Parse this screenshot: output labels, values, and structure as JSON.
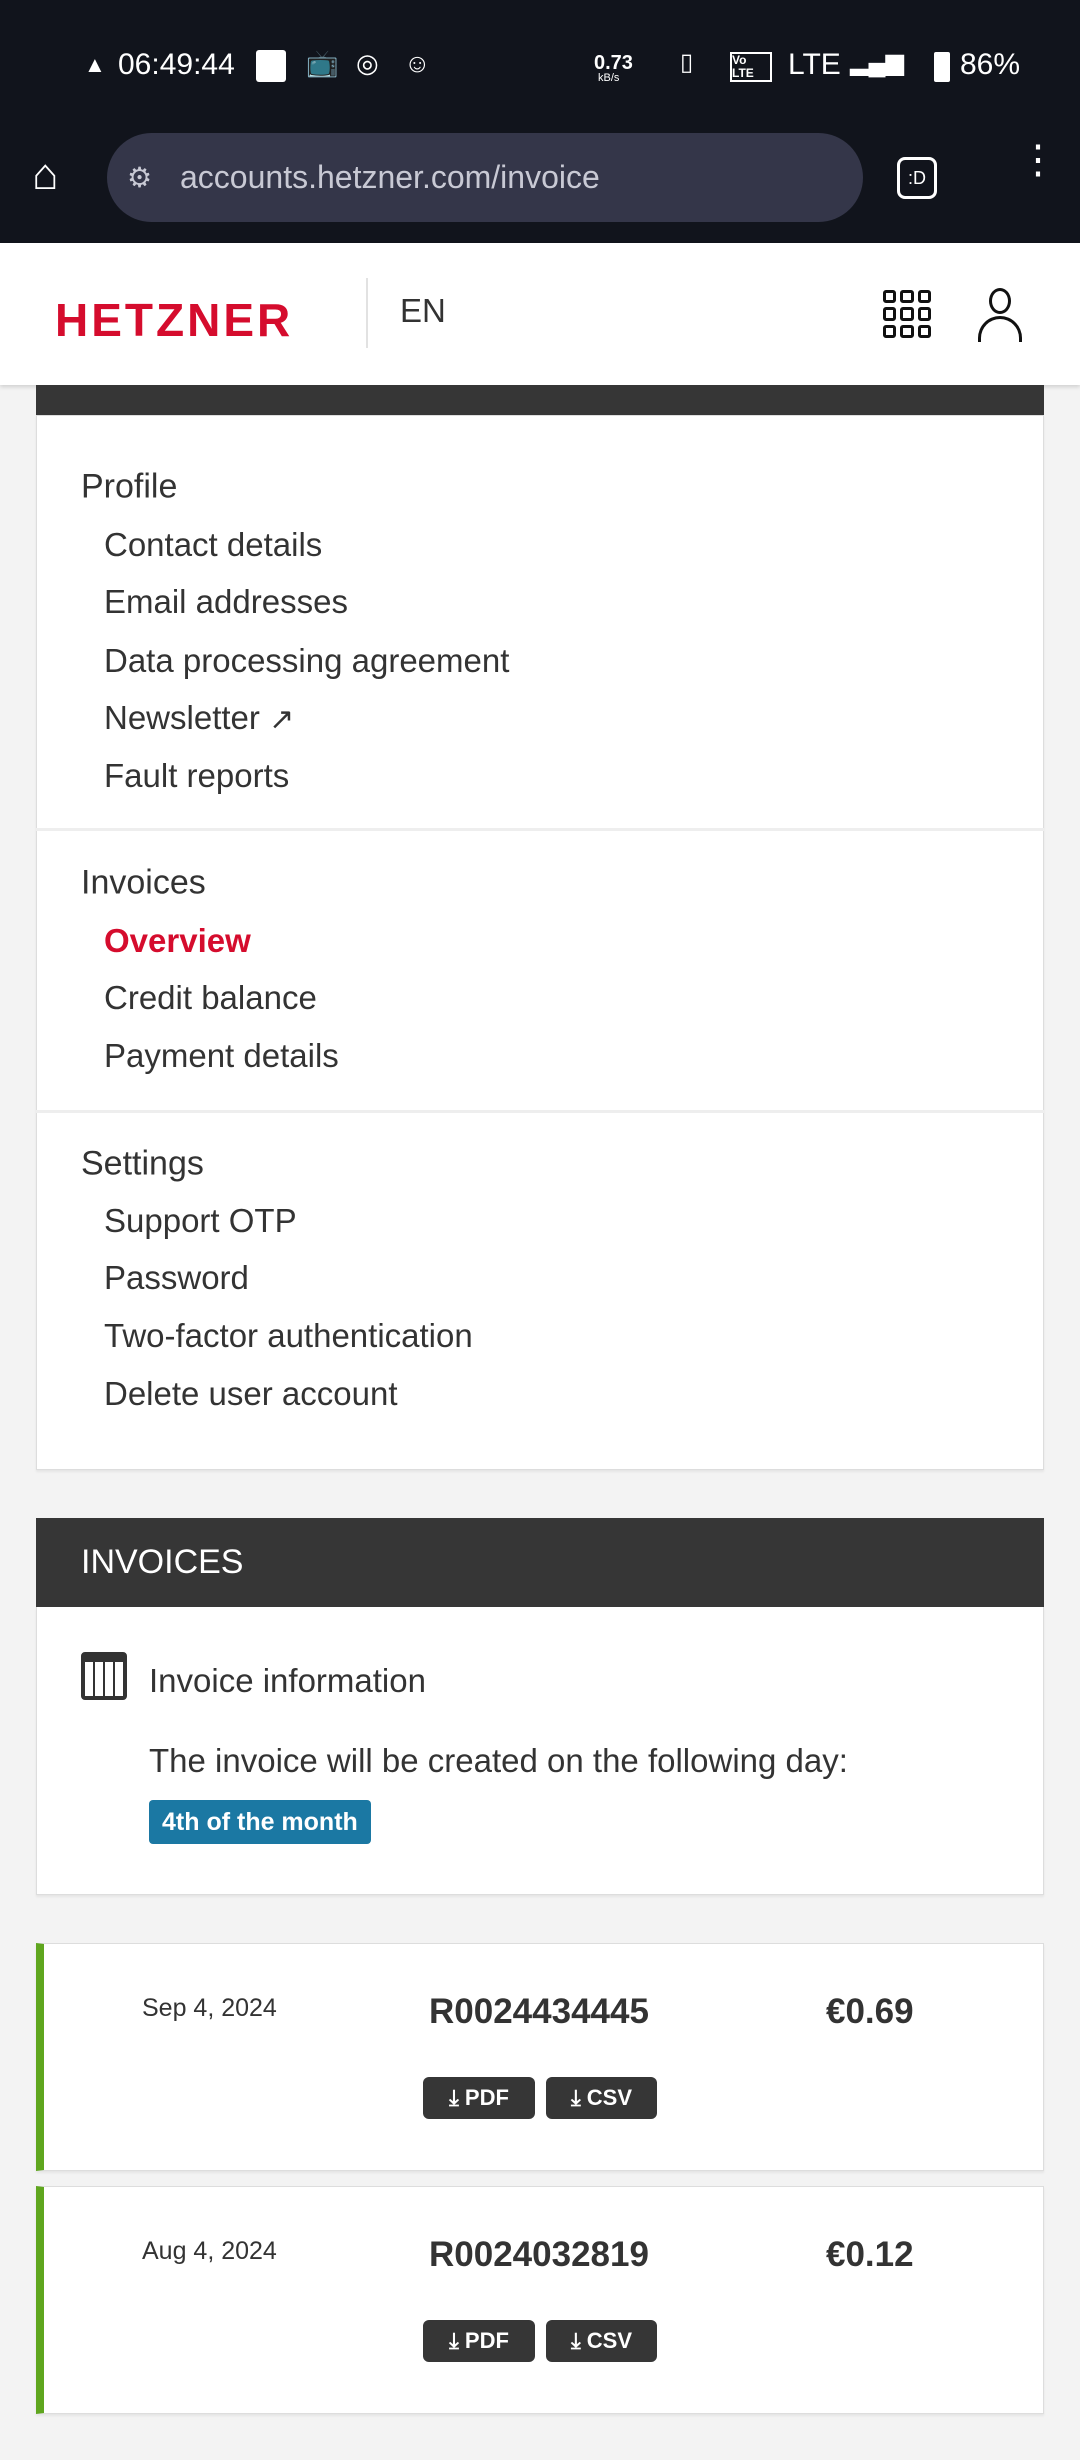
{
  "status_bar": {
    "time": "06:49:44",
    "net_speed": "0.73",
    "net_unit": "kB/s",
    "network": "LTE",
    "battery": "86%"
  },
  "browser": {
    "url": "accounts.hetzner.com/invoice",
    "tab_label": ":D"
  },
  "header": {
    "logo": "HETZNER",
    "language": "EN"
  },
  "menu": {
    "sections": [
      {
        "title": "Profile",
        "items": [
          "Contact details",
          "Email addresses",
          "Data processing agreement",
          "Newsletter",
          "Fault reports"
        ]
      },
      {
        "title": "Invoices",
        "items": [
          "Overview",
          "Credit balance",
          "Payment details"
        ]
      },
      {
        "title": "Settings",
        "items": [
          "Support OTP",
          "Password",
          "Two-factor authentication",
          "Delete user account"
        ]
      }
    ]
  },
  "invoices": {
    "heading": "INVOICES",
    "info_title": "Invoice information",
    "info_text": "The invoice will be created on the following day:",
    "info_badge": "4th of the month",
    "rows": [
      {
        "date": "Sep 4, 2024",
        "number": "R0024434445",
        "amount": "€0.69",
        "pdf": "PDF",
        "csv": "CSV"
      },
      {
        "date": "Aug 4, 2024",
        "number": "R0024032819",
        "amount": "€0.12",
        "pdf": "PDF",
        "csv": "CSV"
      }
    ]
  },
  "colors": {
    "brand": "#d50c2d",
    "status_paid": "#5fa61e",
    "badge": "#1b78a3"
  }
}
